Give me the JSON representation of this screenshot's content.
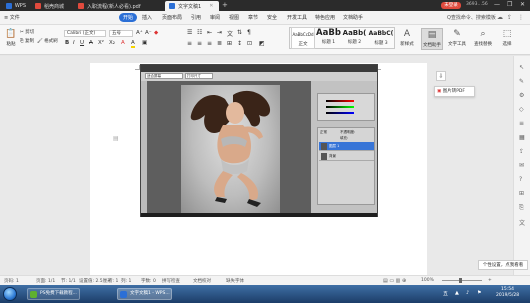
{
  "app": {
    "name": "WPS",
    "tabs": [
      {
        "label": "WPS",
        "color": "#2b6fd6"
      },
      {
        "label": "稻壳商城",
        "color": "#e04a3d"
      },
      {
        "label": "入职流程(新人必看).pdf",
        "color": "#e04a3d"
      },
      {
        "label": "文字文稿1",
        "color": "#2b6fd6"
      }
    ],
    "login": "未登录",
    "user_id": "3693…56"
  },
  "menu": {
    "file": "≡ 文件",
    "items": [
      "开始",
      "插入",
      "页面布局",
      "引用",
      "审阅",
      "视图",
      "章节",
      "安全",
      "开发工具",
      "特色应用",
      "文档助手"
    ],
    "active": "开始",
    "search": "Q查找命令、搜索模板"
  },
  "ribbon": {
    "paste": "粘贴",
    "cut": "剪切",
    "copy": "复制",
    "format_painter": "格式刷",
    "font_name": "Calibri (正文)",
    "font_size": "五号",
    "bold": "B",
    "italic": "I",
    "underline": "U",
    "strike": "A",
    "superscript": "X²",
    "subscript": "X₂",
    "font_color": "A",
    "highlight": "A",
    "styles": [
      {
        "preview": "AaBbCcDd",
        "label": "正文"
      },
      {
        "preview": "AaBb",
        "label": "标题 1"
      },
      {
        "preview": "AaBb(",
        "label": "标题 2"
      },
      {
        "preview": "AaBbC(",
        "label": "标题 3"
      }
    ],
    "new_style": "新样式",
    "doc_assistant": "文档助手",
    "text_tools": "文字工具",
    "find_replace": "查找替换",
    "select": "选择"
  },
  "photoshop": {
    "options_fields": [
      "适合屏幕",
      "打印尺寸"
    ],
    "layers": [
      {
        "name": "图层 1",
        "selected": true
      },
      {
        "name": "背景",
        "selected": false
      }
    ],
    "opacity_label": "不透明度:",
    "fill_label": "填充:",
    "layer_mode": "正常"
  },
  "export_pdf": {
    "icon": "export-pdf-icon",
    "label": "图片转PDF",
    "accent": "#d33"
  },
  "toast": "个性设置，点我看看",
  "status": {
    "page": "页码: 1",
    "section": "页面: 1/1",
    "sections": "节: 1/1",
    "position": "设置值: 2.5厘米",
    "row": "行: 1",
    "col": "列: 1",
    "words": "字数: 0",
    "spell": "拼写检查",
    "doc_check": "文档校对",
    "unsaved": "缺失字体",
    "zoom": "100%"
  },
  "taskbar": {
    "tasks": [
      "PS免费下载教程...",
      "文字文稿1 - WPS..."
    ],
    "time": "15:54",
    "date": "2019/5/28"
  }
}
